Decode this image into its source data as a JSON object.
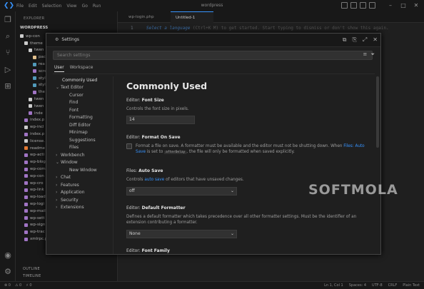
{
  "window": {
    "title": "wordpress",
    "menu": [
      "File",
      "Edit",
      "Selection",
      "View",
      "Go",
      "Run"
    ]
  },
  "sidebar": {
    "header": "EXPLORER",
    "root": "WORDPRESS",
    "items": [
      {
        "label": "wp-con",
        "color": "#cccccc"
      },
      {
        "label": "theme",
        "color": "#cccccc"
      },
      {
        "label": "twen",
        "color": "#cccccc"
      },
      {
        "label": "pac",
        "color": "#e2c08d"
      },
      {
        "label": "rea",
        "color": "#519aba"
      },
      {
        "label": "scre",
        "color": "#a074c4"
      },
      {
        "label": "styl",
        "color": "#519aba"
      },
      {
        "label": "styl",
        "color": "#519aba"
      },
      {
        "label": "the",
        "color": "#a074c4"
      },
      {
        "label": "twen",
        "color": "#cccccc"
      },
      {
        "label": "twen",
        "color": "#cccccc"
      },
      {
        "label": "inde",
        "color": "#a074c4"
      },
      {
        "label": "index.p",
        "color": "#a074c4"
      },
      {
        "label": "wp-incl",
        "color": "#cccccc"
      },
      {
        "label": "index.p",
        "color": "#a074c4"
      },
      {
        "label": "license.",
        "color": "#cccccc"
      },
      {
        "label": "readme",
        "color": "#e37933"
      },
      {
        "label": "wp-acti",
        "color": "#a074c4"
      },
      {
        "label": "wp-blog",
        "color": "#a074c4"
      },
      {
        "label": "wp-com",
        "color": "#a074c4"
      },
      {
        "label": "wp-con",
        "color": "#a074c4"
      },
      {
        "label": "wp-cro",
        "color": "#a074c4"
      },
      {
        "label": "wp-link",
        "color": "#a074c4"
      },
      {
        "label": "wp-load",
        "color": "#a074c4"
      },
      {
        "label": "wp-logi",
        "color": "#a074c4"
      },
      {
        "label": "wp-mail",
        "color": "#a074c4"
      },
      {
        "label": "wp-sett",
        "color": "#a074c4"
      },
      {
        "label": "wp-sign",
        "color": "#a074c4"
      },
      {
        "label": "wp-trac",
        "color": "#a074c4"
      },
      {
        "label": "xmlrpc.php",
        "color": "#a074c4"
      }
    ],
    "outline": "OUTLINE",
    "timeline": "TIMELINE"
  },
  "editor": {
    "tabs": [
      "wp-login.php",
      "Untitled-1"
    ],
    "line_number": "1",
    "code_text": "Select a language",
    "code_rest": " (Ctrl+K M) to get started. Start typing to dismiss or don't show this again."
  },
  "settings": {
    "title": "Settings",
    "search_placeholder": "Search settings",
    "scopes": [
      "User",
      "Workspace"
    ],
    "toc": [
      {
        "label": "Commonly Used",
        "indent": 0,
        "chevron": ""
      },
      {
        "label": "Text Editor",
        "indent": 0,
        "chevron": "v"
      },
      {
        "label": "Cursor",
        "indent": 1,
        "chevron": ""
      },
      {
        "label": "Find",
        "indent": 1,
        "chevron": ""
      },
      {
        "label": "Font",
        "indent": 1,
        "chevron": ""
      },
      {
        "label": "Formatting",
        "indent": 1,
        "chevron": ""
      },
      {
        "label": "Diff Editor",
        "indent": 1,
        "chevron": ""
      },
      {
        "label": "Minimap",
        "indent": 1,
        "chevron": ""
      },
      {
        "label": "Suggestions",
        "indent": 1,
        "chevron": ""
      },
      {
        "label": "Files",
        "indent": 1,
        "chevron": ""
      },
      {
        "label": "Workbench",
        "indent": 0,
        "chevron": ">"
      },
      {
        "label": "Window",
        "indent": 0,
        "chevron": "v"
      },
      {
        "label": "New Window",
        "indent": 1,
        "chevron": ""
      },
      {
        "label": "Chat",
        "indent": 0,
        "chevron": ">"
      },
      {
        "label": "Features",
        "indent": 0,
        "chevron": ">"
      },
      {
        "label": "Application",
        "indent": 0,
        "chevron": ">"
      },
      {
        "label": "Security",
        "indent": 0,
        "chevron": ">"
      },
      {
        "label": "Extensions",
        "indent": 0,
        "chevron": ">"
      }
    ],
    "heading": "Commonly Used",
    "font_size": {
      "prefix": "Editor: ",
      "name": "Font Size",
      "desc": "Controls the font size in pixels.",
      "value": "14"
    },
    "format_on_save": {
      "prefix": "Editor: ",
      "name": "Format On Save",
      "desc_a": "Format a file on save. A formatter must be available and the editor must not be shutting down. When ",
      "link": "Files: Auto Save",
      "desc_b": " is set to ",
      "code": "afterDelay",
      "desc_c": ", the file will only be formatted when saved explicitly.",
      "checked": false
    },
    "auto_save": {
      "prefix": "Files: ",
      "name": "Auto Save",
      "desc_a": "Controls ",
      "link": "auto save",
      "desc_b": " of editors that have unsaved changes.",
      "value": "off"
    },
    "default_formatter": {
      "prefix": "Editor: ",
      "name": "Default Formatter",
      "desc": "Defines a default formatter which takes precedence over all other formatter settings. Must be the identifier of an extension contributing a formatter.",
      "value": "None"
    },
    "font_family": {
      "prefix": "Editor: ",
      "name": "Font Family"
    }
  },
  "statusbar": {
    "left": [
      "⊗ 0",
      "⚠ 0",
      "⚡ 0"
    ],
    "right": [
      "Ln 1, Col 1",
      "Spaces: 4",
      "UTF-8",
      "CRLF",
      "Plain Text"
    ]
  },
  "watermark": "SOFTMOLA",
  "colors": {
    "accent": "#3794ff",
    "background": "#1e1e1e",
    "panel": "#181818"
  },
  "icons": {
    "activity": [
      "files-icon",
      "search-icon",
      "source-control-icon",
      "run-debug-icon",
      "extensions-icon",
      "account-icon",
      "manage-gear-icon"
    ]
  }
}
